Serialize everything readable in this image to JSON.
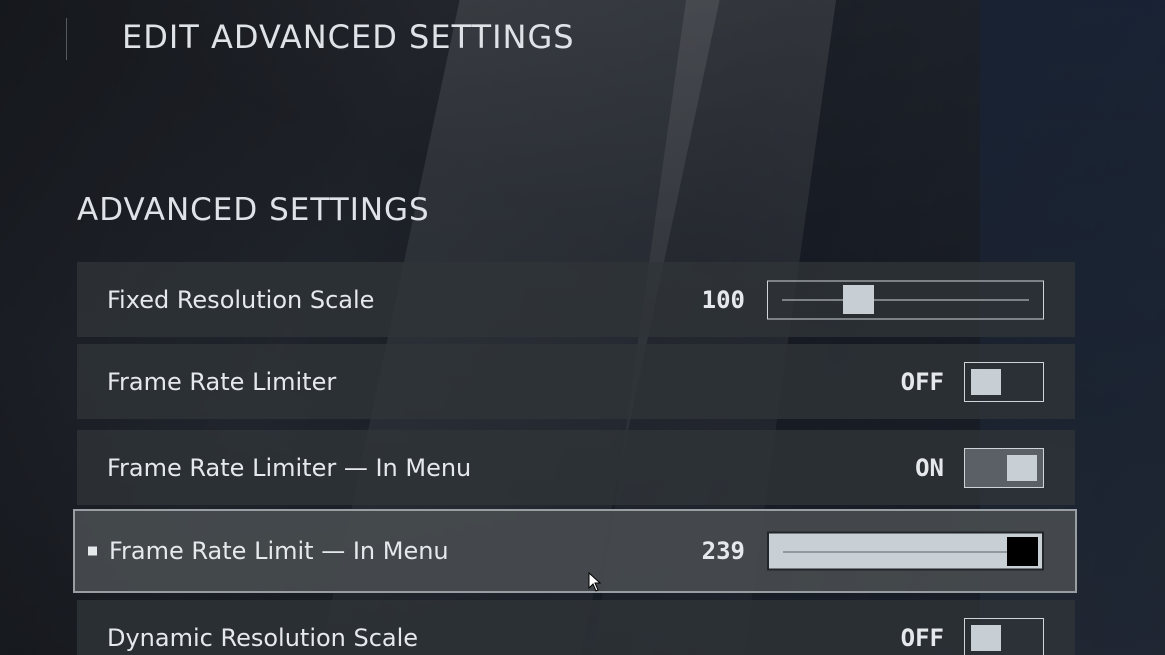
{
  "header": {
    "title": "EDIT ADVANCED SETTINGS"
  },
  "section": {
    "title": "ADVANCED SETTINGS"
  },
  "settings": [
    {
      "label": "Fixed Resolution Scale",
      "value": "100",
      "control": "slider",
      "level": 0.3
    },
    {
      "label": "Frame Rate Limiter",
      "value": "OFF",
      "control": "toggle",
      "state": "off"
    },
    {
      "label": "Frame Rate Limiter — In Menu",
      "value": "ON",
      "control": "toggle",
      "state": "on"
    },
    {
      "label": "Frame Rate Limit — In Menu",
      "value": "239",
      "control": "slider",
      "level": 1.0,
      "selected": true
    },
    {
      "label": "Dynamic Resolution Scale",
      "value": "OFF",
      "control": "toggle",
      "state": "off"
    }
  ],
  "colors": {
    "accent": "#c7ced4",
    "row_bg": "#303438",
    "selected_border": "#bec3c8"
  }
}
